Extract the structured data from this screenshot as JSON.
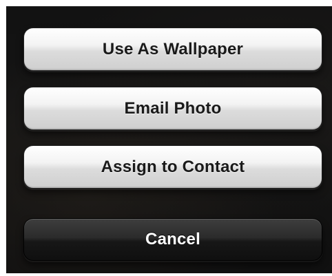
{
  "action_sheet": {
    "buttons": [
      {
        "label": "Use As Wallpaper",
        "style": "light"
      },
      {
        "label": "Email Photo",
        "style": "light"
      },
      {
        "label": "Assign to Contact",
        "style": "light"
      }
    ],
    "cancel": {
      "label": "Cancel",
      "style": "dark"
    }
  }
}
